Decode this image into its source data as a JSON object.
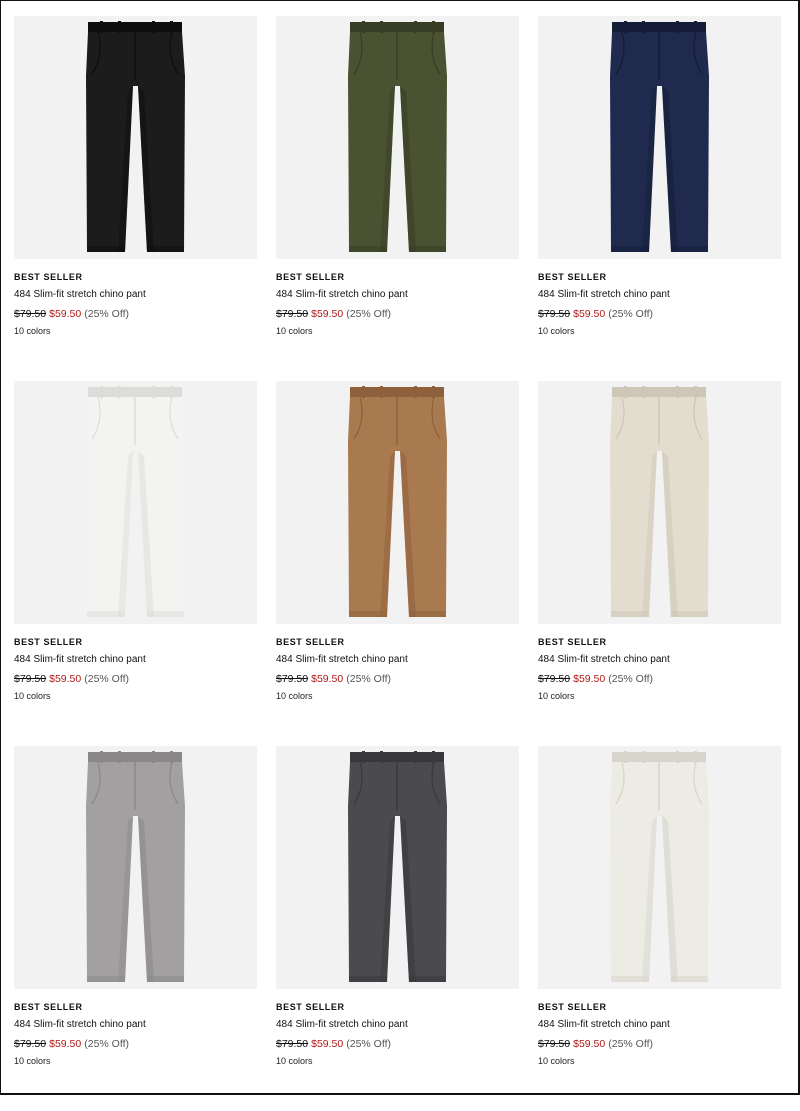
{
  "products": [
    {
      "badge": "BEST SELLER",
      "title": "484 Slim-fit stretch chino pant",
      "price_original": "$79.50",
      "price_sale": "$59.50",
      "discount": "(25% Off)",
      "colors": "10 colors",
      "color_hex": "#1c1c1c",
      "shade_hex": "#0e0e0e"
    },
    {
      "badge": "BEST SELLER",
      "title": "484 Slim-fit stretch chino pant",
      "price_original": "$79.50",
      "price_sale": "$59.50",
      "discount": "(25% Off)",
      "colors": "10 colors",
      "color_hex": "#4a5232",
      "shade_hex": "#363d24"
    },
    {
      "badge": "BEST SELLER",
      "title": "484 Slim-fit stretch chino pant",
      "price_original": "$79.50",
      "price_sale": "$59.50",
      "discount": "(25% Off)",
      "colors": "10 colors",
      "color_hex": "#1f2a4e",
      "shade_hex": "#141c37"
    },
    {
      "badge": "BEST SELLER",
      "title": "484 Slim-fit stretch chino pant",
      "price_original": "$79.50",
      "price_sale": "$59.50",
      "discount": "(25% Off)",
      "colors": "10 colors",
      "color_hex": "#f3f3f1",
      "shade_hex": "#dcdcd8"
    },
    {
      "badge": "BEST SELLER",
      "title": "484 Slim-fit stretch chino pant",
      "price_original": "$79.50",
      "price_sale": "$59.50",
      "discount": "(25% Off)",
      "colors": "10 colors",
      "color_hex": "#a9794f",
      "shade_hex": "#8e613c"
    },
    {
      "badge": "BEST SELLER",
      "title": "484 Slim-fit stretch chino pant",
      "price_original": "$79.50",
      "price_sale": "$59.50",
      "discount": "(25% Off)",
      "colors": "10 colors",
      "color_hex": "#e3ddd0",
      "shade_hex": "#cec6b6"
    },
    {
      "badge": "BEST SELLER",
      "title": "484 Slim-fit stretch chino pant",
      "price_original": "$79.50",
      "price_sale": "$59.50",
      "discount": "(25% Off)",
      "colors": "10 colors",
      "color_hex": "#a3a0a2",
      "shade_hex": "#8a8789"
    },
    {
      "badge": "BEST SELLER",
      "title": "484 Slim-fit stretch chino pant",
      "price_original": "$79.50",
      "price_sale": "$59.50",
      "discount": "(25% Off)",
      "colors": "10 colors",
      "color_hex": "#4b4b4f",
      "shade_hex": "#38383c"
    },
    {
      "badge": "BEST SELLER",
      "title": "484 Slim-fit stretch chino pant",
      "price_original": "$79.50",
      "price_sale": "$59.50",
      "discount": "(25% Off)",
      "colors": "10 colors",
      "color_hex": "#ecebe4",
      "shade_hex": "#d6d4cb"
    }
  ]
}
